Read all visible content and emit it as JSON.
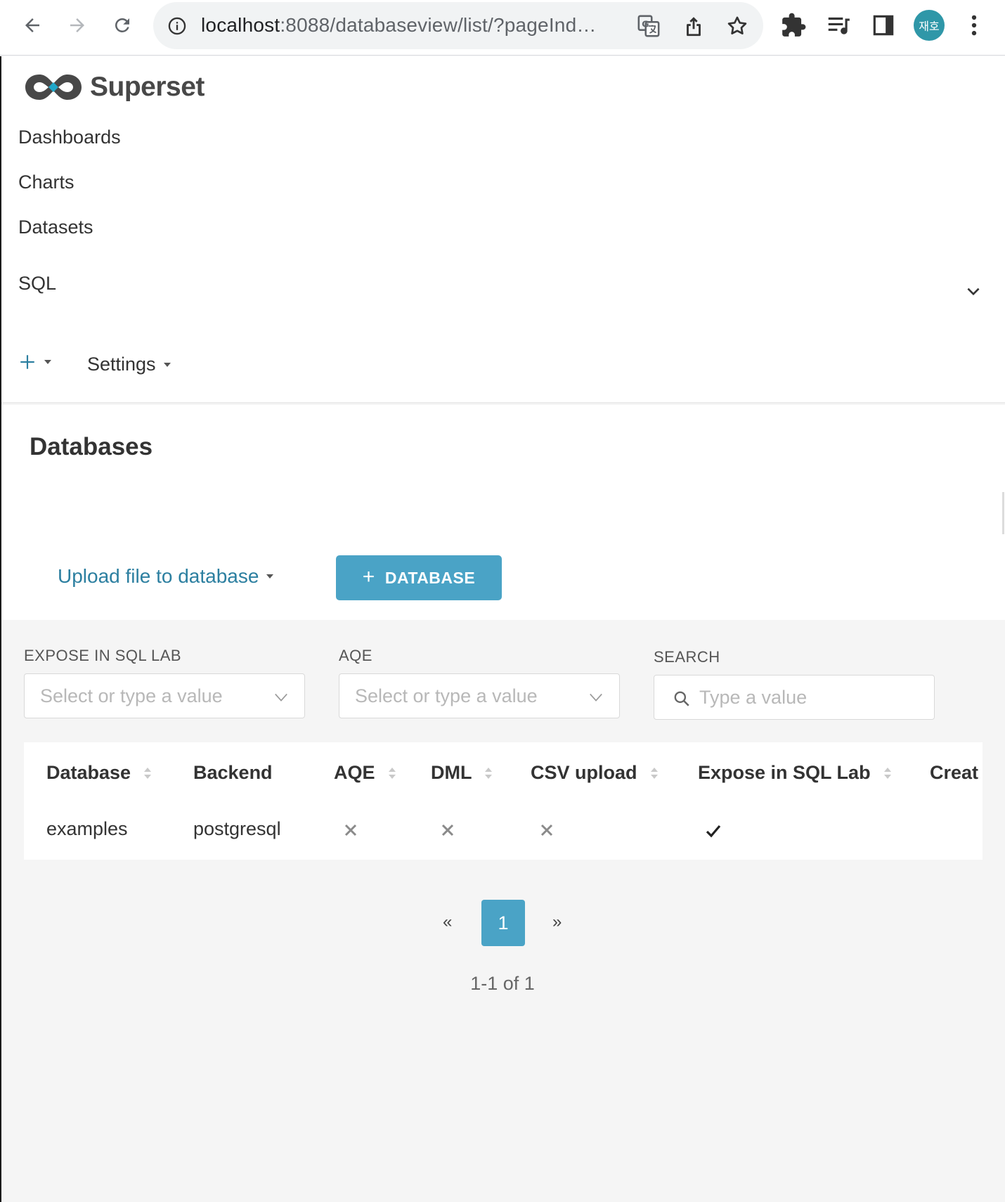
{
  "browser": {
    "url_host": "localhost",
    "url_rest": ":8088/databaseview/list/?pageInd…",
    "profile_initials": "재호"
  },
  "app": {
    "brand": "Superset",
    "menu": {
      "dashboards": "Dashboards",
      "charts": "Charts",
      "datasets": "Datasets",
      "sql": "SQL",
      "settings": "Settings"
    }
  },
  "page": {
    "title": "Databases",
    "upload_link": "Upload file to database",
    "add_button": "DATABASE"
  },
  "filters": {
    "expose_label": "EXPOSE IN SQL LAB",
    "expose_placeholder": "Select or type a value",
    "aqe_label": "AQE",
    "aqe_placeholder": "Select or type a value",
    "search_label": "SEARCH",
    "search_placeholder": "Type a value"
  },
  "table": {
    "columns": [
      "Database",
      "Backend",
      "AQE",
      "DML",
      "CSV upload",
      "Expose in SQL Lab",
      "Creat"
    ],
    "rows": [
      {
        "database": "examples",
        "backend": "postgresql",
        "aqe": "false",
        "dml": "false",
        "csv_upload": "false",
        "expose_in_sql_lab": "true"
      }
    ]
  },
  "pagination": {
    "prev": "«",
    "current_page": "1",
    "next": "»",
    "summary": "1-1 of 1"
  },
  "colors": {
    "accent": "#4aa3c6",
    "link": "#2c7fa0",
    "avatar": "#2f97a8"
  }
}
